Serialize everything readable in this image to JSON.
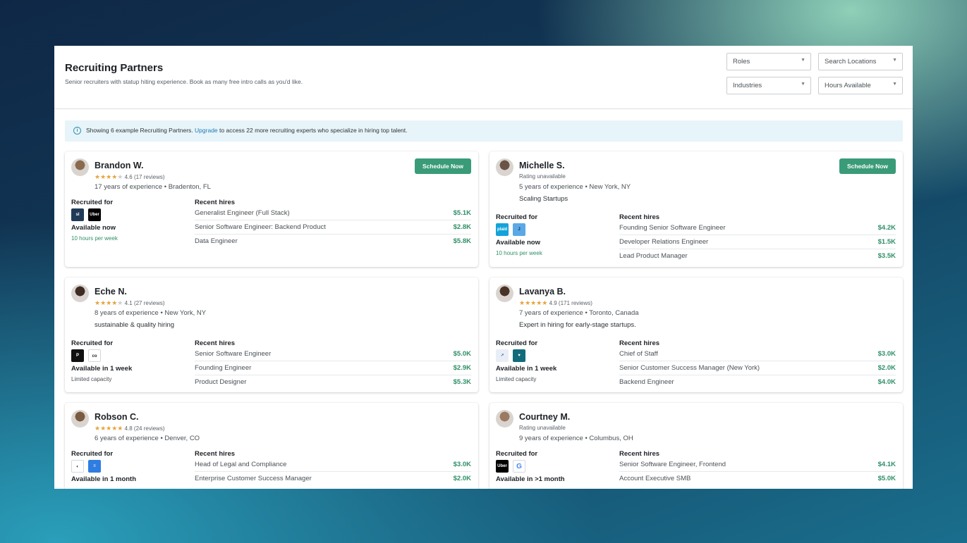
{
  "header": {
    "title": "Recruiting Partners",
    "subtitle": "Senior recruiters with statup hiting experience. Book as many free intro calls as you'd like."
  },
  "filters": {
    "roles": "Roles",
    "locations": "Search Locations",
    "industries": "Industries",
    "hours": "Hours Available"
  },
  "banner": {
    "before": "Showing 6 example Recruiting Partners.",
    "link": "Upgrade",
    "after": "to access 22 more recruiting experts who specialize in hiring top talent."
  },
  "labels": {
    "schedule": "Schedule Now",
    "recruited_for": "Recruited for",
    "recent_hires": "Recent hires"
  },
  "partners": [
    {
      "name": "Brandon W.",
      "rating_value": 4.6,
      "rating_text": "4.6 (17 reviews)",
      "experience": "17 years of experience • Bradenton, FL",
      "tagline": "",
      "logos": [
        "slite-logo",
        "uber-logo"
      ],
      "availability": "Available now",
      "availability_detail": "10 hours per week",
      "hires": [
        {
          "role": "Generalist Engineer (Full Stack)",
          "amount": "$5.1K"
        },
        {
          "role": "Senior Software Engineer: Backend Product",
          "amount": "$2.8K"
        },
        {
          "role": "Data Engineer",
          "amount": "$5.8K"
        }
      ]
    },
    {
      "name": "Michelle S.",
      "rating_value": null,
      "rating_text": "Rating unavailable",
      "experience": "5 years of experience • New York, NY",
      "tagline": "Scaling Startups",
      "logos": [
        "plaid-logo",
        "jasper-logo"
      ],
      "availability": "Available now",
      "availability_detail": "10 hours per week",
      "hires": [
        {
          "role": "Founding Senior Software Engineer",
          "amount": "$4.2K"
        },
        {
          "role": "Developer Relations Engineer",
          "amount": "$1.5K"
        },
        {
          "role": "Lead Product Manager",
          "amount": "$3.5K"
        }
      ]
    },
    {
      "name": "Eche N.",
      "rating_value": 4.1,
      "rating_text": "4.1 (27 reviews)",
      "experience": "8 years of experience • New York, NY",
      "tagline": "sustainable & quality hiring",
      "logos": [
        "peloton-logo",
        "company-logo"
      ],
      "availability": "Available in 1 week",
      "availability_detail": "Limited capacity",
      "hires": [
        {
          "role": "Senior Software Engineer",
          "amount": "$5.0K"
        },
        {
          "role": "Founding Engineer",
          "amount": "$2.9K"
        },
        {
          "role": "Product Designer",
          "amount": "$5.3K"
        }
      ]
    },
    {
      "name": "Lavanya B.",
      "rating_value": 4.9,
      "rating_text": "4.9 (171 reviews)",
      "experience": "7 years of experience • Toronto, Canada",
      "tagline": "Expert in hiring for early-stage startups.",
      "logos": [
        "arrow-logo",
        "heart-logo"
      ],
      "availability": "Available in 1 week",
      "availability_detail": "Limited capacity",
      "hires": [
        {
          "role": "Chief of Staff",
          "amount": "$3.0K"
        },
        {
          "role": "Senior Customer Success Manager (New York)",
          "amount": "$2.0K"
        },
        {
          "role": "Backend Engineer",
          "amount": "$4.0K"
        }
      ]
    },
    {
      "name": "Robson C.",
      "rating_value": 4.8,
      "rating_text": "4.8 (24 reviews)",
      "experience": "6 years of experience • Denver, CO",
      "tagline": "",
      "logos": [
        "mascot-logo",
        "docs-logo"
      ],
      "availability": "Available in 1 month",
      "availability_detail": "",
      "hires": [
        {
          "role": "Head of Legal and Compliance",
          "amount": "$3.0K"
        },
        {
          "role": "Enterprise Customer Success Manager",
          "amount": "$2.0K"
        }
      ]
    },
    {
      "name": "Courtney M.",
      "rating_value": null,
      "rating_text": "Rating unavailable",
      "experience": "9 years of experience • Columbus, OH",
      "tagline": "",
      "logos": [
        "uber-logo",
        "google-logo"
      ],
      "availability": "Available in >1 month",
      "availability_detail": "",
      "hires": [
        {
          "role": "Senior Software Engineer, Frontend",
          "amount": "$4.1K"
        },
        {
          "role": "Account Executive SMB",
          "amount": "$5.0K"
        }
      ]
    }
  ],
  "colors": {
    "accent_green": "#3a9b78",
    "amount_green": "#2f8f68",
    "availability_now": "#2f8f68",
    "star": "#e8a33c",
    "link": "#1f7bb4"
  }
}
